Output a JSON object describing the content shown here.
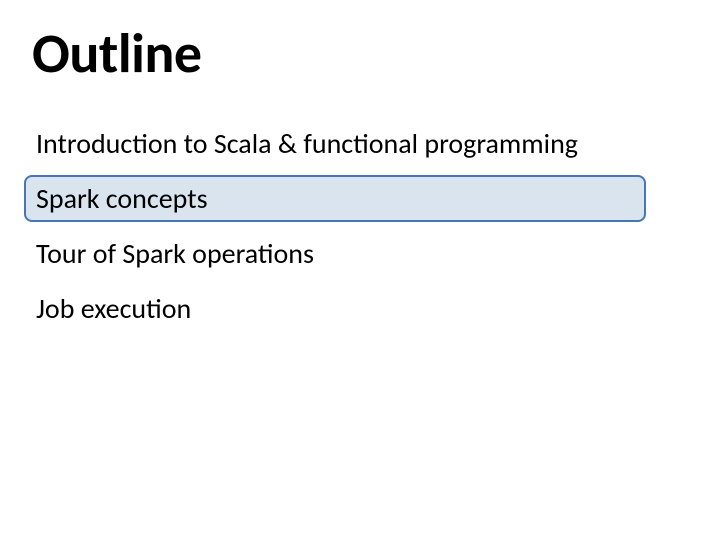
{
  "slide": {
    "title": "Outline",
    "items": [
      {
        "label": "Introduction to Scala & functional programming",
        "highlighted": false
      },
      {
        "label": "Spark concepts",
        "highlighted": true
      },
      {
        "label": "Tour of Spark operations",
        "highlighted": false
      },
      {
        "label": "Job execution",
        "highlighted": false
      }
    ],
    "colors": {
      "highlight_fill": "#dae4ef",
      "highlight_border": "#4677b4"
    }
  }
}
